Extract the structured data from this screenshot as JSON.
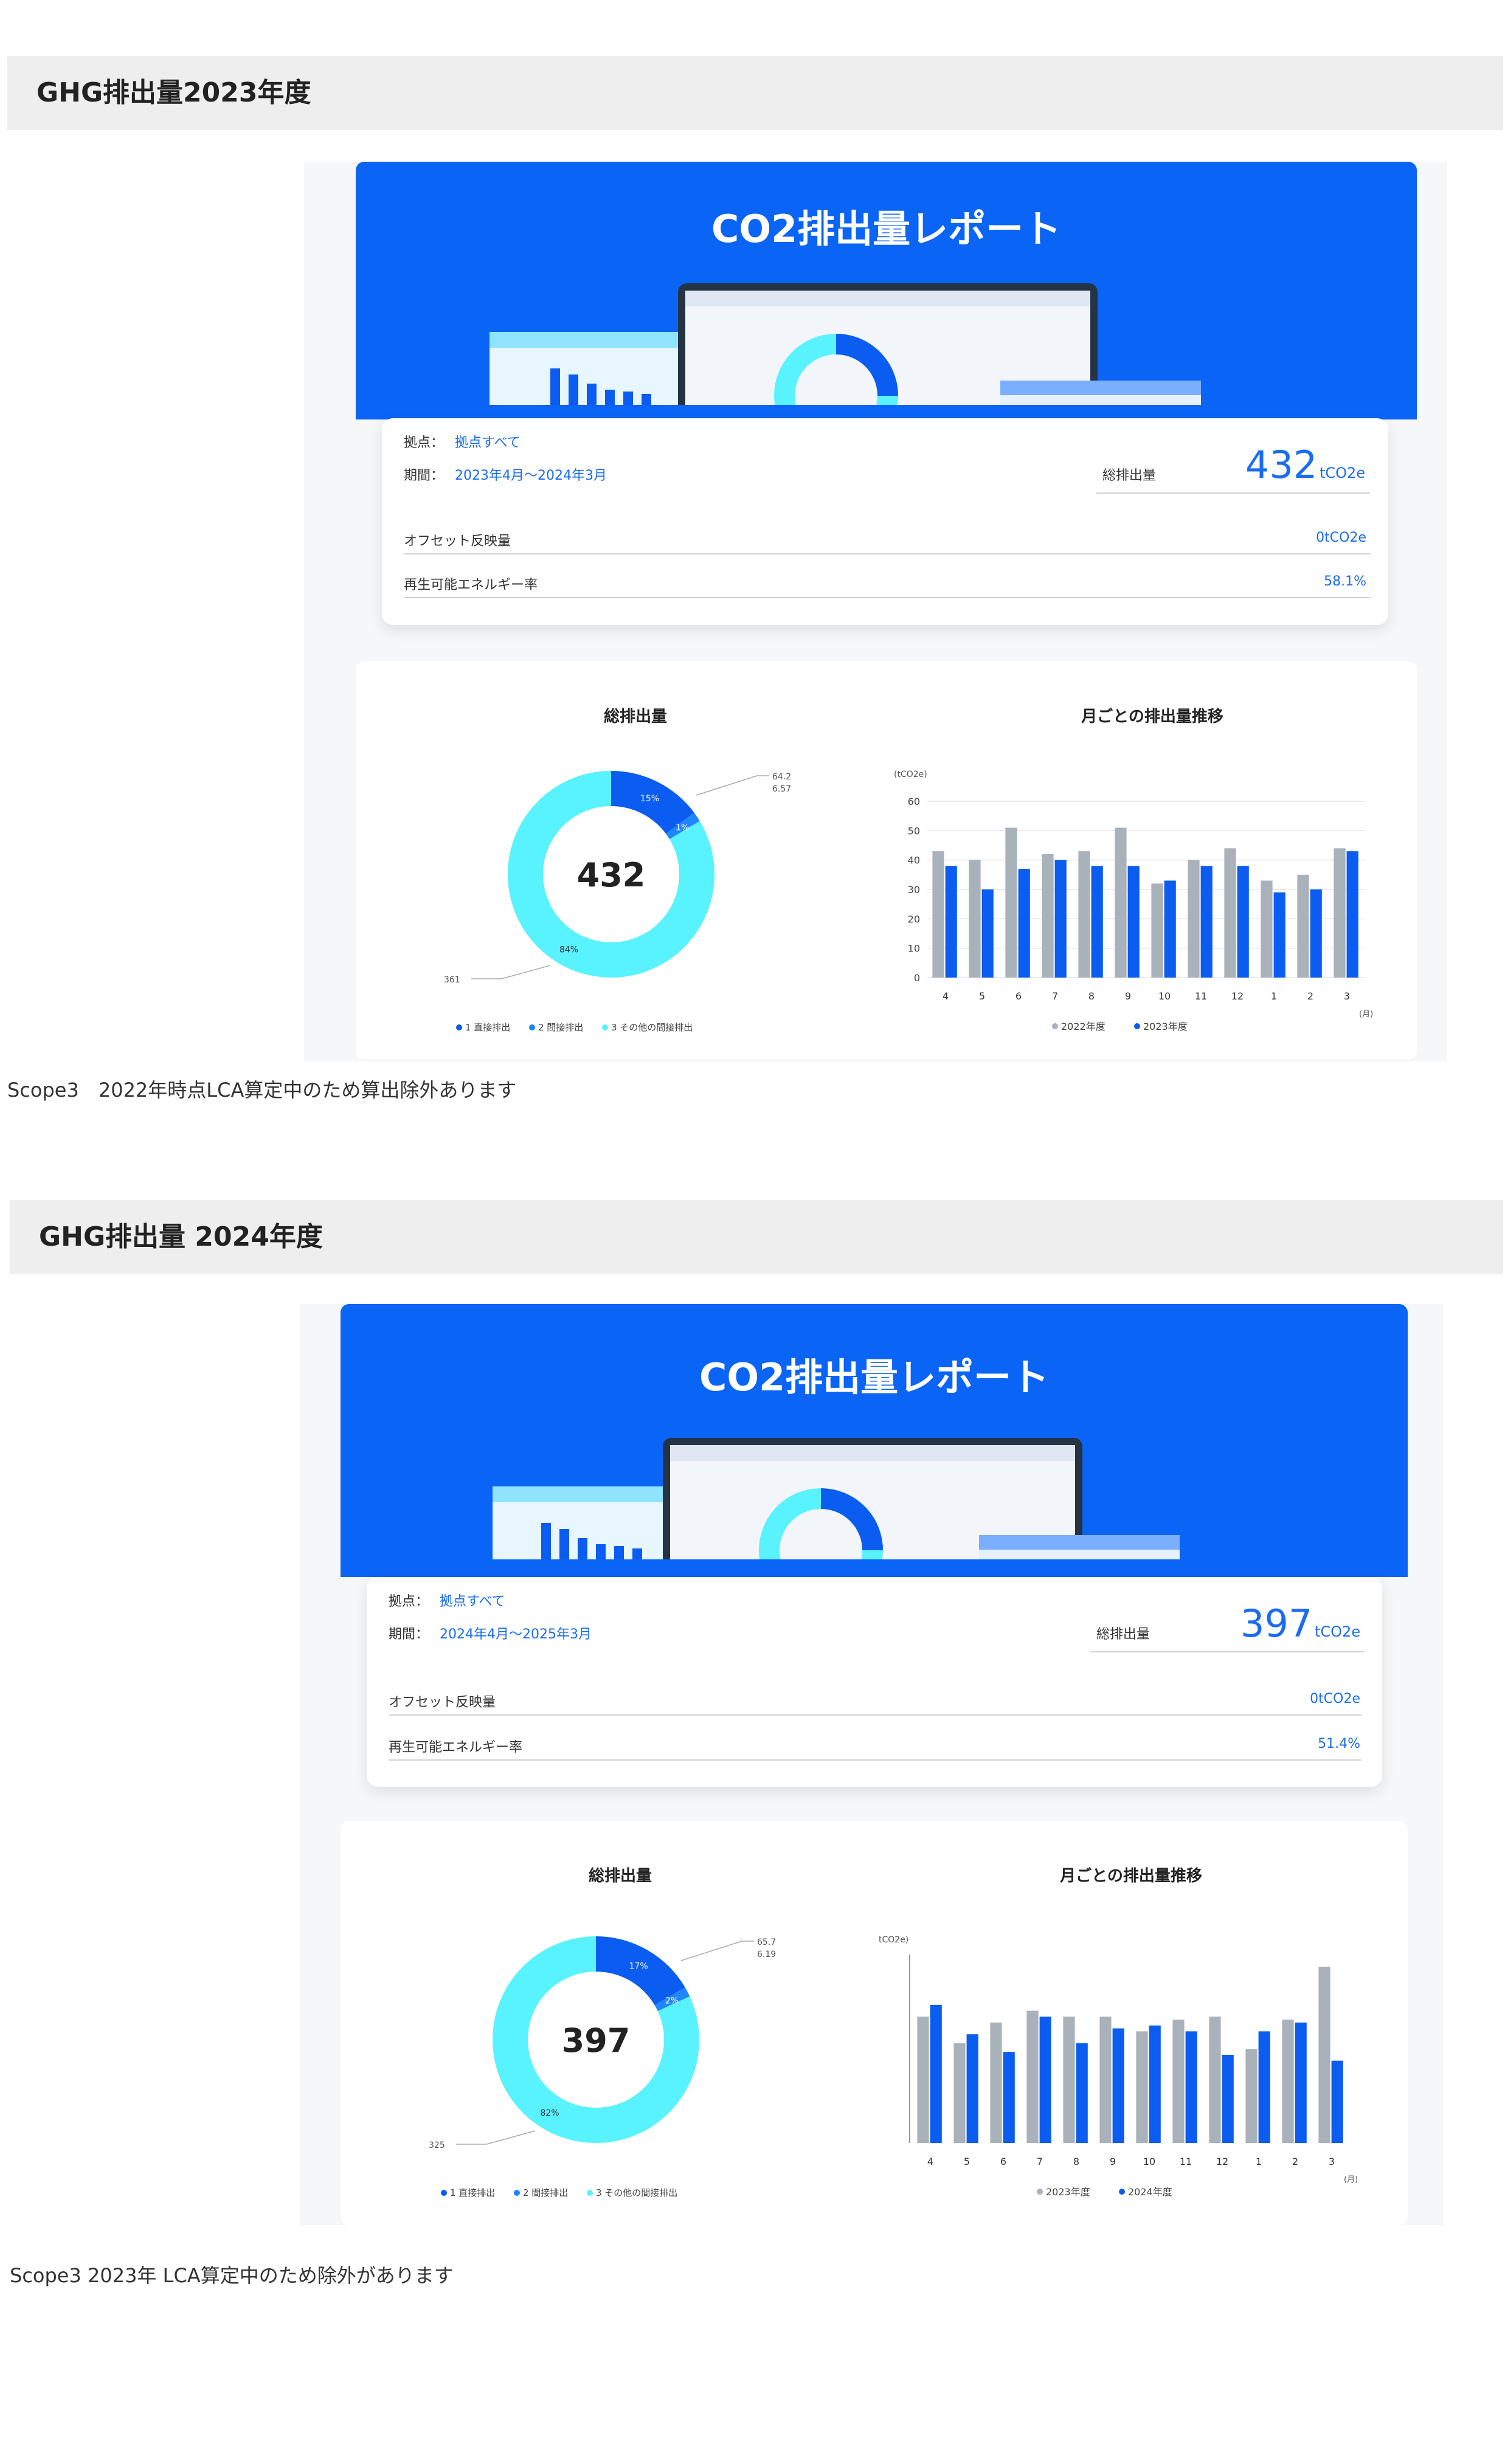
{
  "colors": {
    "blue": "#0a64f5",
    "accent": "#1a6cf0",
    "cyan": "#59f2ff",
    "gray": "#a9b1ba",
    "darkblue": "#0b5cf0"
  },
  "sections": [
    {
      "header": "GHG排出量2023年度",
      "report": {
        "title": "CO2排出量レポート",
        "site_label": "拠点：",
        "site_value": "拠点すべて",
        "period_label": "期間：",
        "period_value": "2023年4月～2024年3月",
        "total_label": "総排出量",
        "total_value": "432",
        "total_unit": "tCO2e",
        "offset_label": "オフセット反映量",
        "offset_value": "0tCO2e",
        "renewable_label": "再生可能エネルギー率",
        "renewable_value": "58.1%"
      },
      "donut_title": "総排出量",
      "bar_title": "月ごとの排出量推移",
      "note": "Scope3　2022年時点LCA算定中のため算出除外あります"
    },
    {
      "header": "GHG排出量 2024年度",
      "report": {
        "title": "CO2排出量レポート",
        "site_label": "拠点：",
        "site_value": "拠点すべて",
        "period_label": "期間：",
        "period_value": "2024年4月～2025年3月",
        "total_label": "総排出量",
        "total_value": "397",
        "total_unit": "tCO2e",
        "offset_label": "オフセット反映量",
        "offset_value": "0tCO2e",
        "renewable_label": "再生可能エネルギー率",
        "renewable_value": "51.4%"
      },
      "donut_title": "総排出量",
      "bar_title": "月ごとの排出量推移",
      "note": "Scope3 2023年 LCA算定中のため除外があります"
    }
  ],
  "chart_data": [
    {
      "type": "pie",
      "center_label": "432",
      "slices": [
        {
          "label": "1 直接排出",
          "value": 64.2,
          "pct_label": "15%",
          "color": "#0b5cf0"
        },
        {
          "label": "2 間接排出",
          "value": 6.57,
          "pct_label": "1%",
          "color": "#1f86ff"
        },
        {
          "label": "3 その他の間接排出",
          "value": 361,
          "pct_label": "84%",
          "color": "#59f2ff"
        }
      ],
      "value_labels": [
        "64.2",
        "6.57",
        "361"
      ]
    },
    {
      "type": "bar",
      "yunit": "(tCO2e)",
      "xunit": "(月)",
      "categories": [
        "4",
        "5",
        "6",
        "7",
        "8",
        "9",
        "10",
        "11",
        "12",
        "1",
        "2",
        "3"
      ],
      "ylim": [
        0,
        60
      ],
      "yticks": [
        0,
        10,
        20,
        30,
        40,
        50,
        60
      ],
      "series": [
        {
          "name": "2022年度",
          "color": "#a9b1ba",
          "values": [
            43,
            40,
            51,
            42,
            43,
            51,
            32,
            40,
            44,
            33,
            35,
            44
          ]
        },
        {
          "name": "2023年度",
          "color": "#0b5cf0",
          "values": [
            38,
            30,
            37,
            40,
            38,
            38,
            33,
            38,
            38,
            29,
            30,
            43
          ]
        }
      ]
    },
    {
      "type": "pie",
      "center_label": "397",
      "slices": [
        {
          "label": "1 直接排出",
          "value": 65.7,
          "pct_label": "17%",
          "color": "#0b5cf0"
        },
        {
          "label": "2 間接排出",
          "value": 6.19,
          "pct_label": "2%",
          "color": "#1f86ff"
        },
        {
          "label": "3 その他の間接排出",
          "value": 325,
          "pct_label": "82%",
          "color": "#59f2ff"
        }
      ],
      "value_labels": [
        "65.7",
        "6.19",
        "325"
      ]
    },
    {
      "type": "bar",
      "yunit": "tCO2e)",
      "xunit": "(月)",
      "categories": [
        "4",
        "5",
        "6",
        "7",
        "8",
        "9",
        "10",
        "11",
        "12",
        "1",
        "2",
        "3"
      ],
      "ylim": [
        0,
        60
      ],
      "yticks": [],
      "series": [
        {
          "name": "2023年度",
          "color": "#a9b1ba",
          "values": [
            43,
            34,
            41,
            45,
            43,
            43,
            38,
            42,
            43,
            32,
            42,
            60
          ]
        },
        {
          "name": "2024年度",
          "color": "#0b5cf0",
          "values": [
            47,
            37,
            31,
            43,
            34,
            39,
            40,
            38,
            30,
            38,
            41,
            28
          ]
        }
      ]
    }
  ]
}
